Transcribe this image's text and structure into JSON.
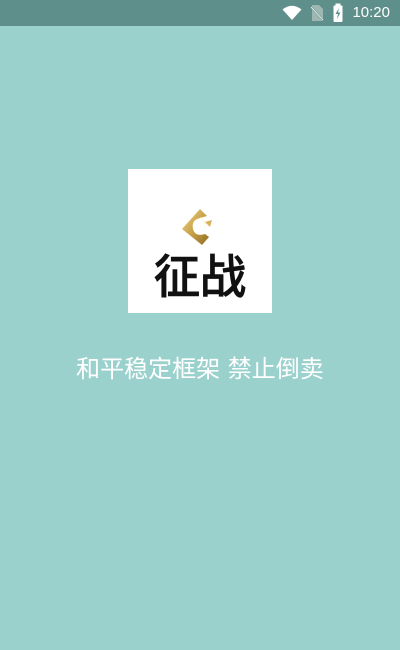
{
  "status_bar": {
    "time": "10:20",
    "icons": [
      "wifi-icon",
      "no-sim-icon",
      "battery-charging-icon"
    ]
  },
  "splash": {
    "logo_text": "征战",
    "tagline": "和平稳定框架 禁止倒卖"
  },
  "colors": {
    "background": "#9bd1cd",
    "status_bar": "#5f8f8a",
    "logo_gold": "#c9a24a",
    "logo_tile": "#ffffff"
  }
}
